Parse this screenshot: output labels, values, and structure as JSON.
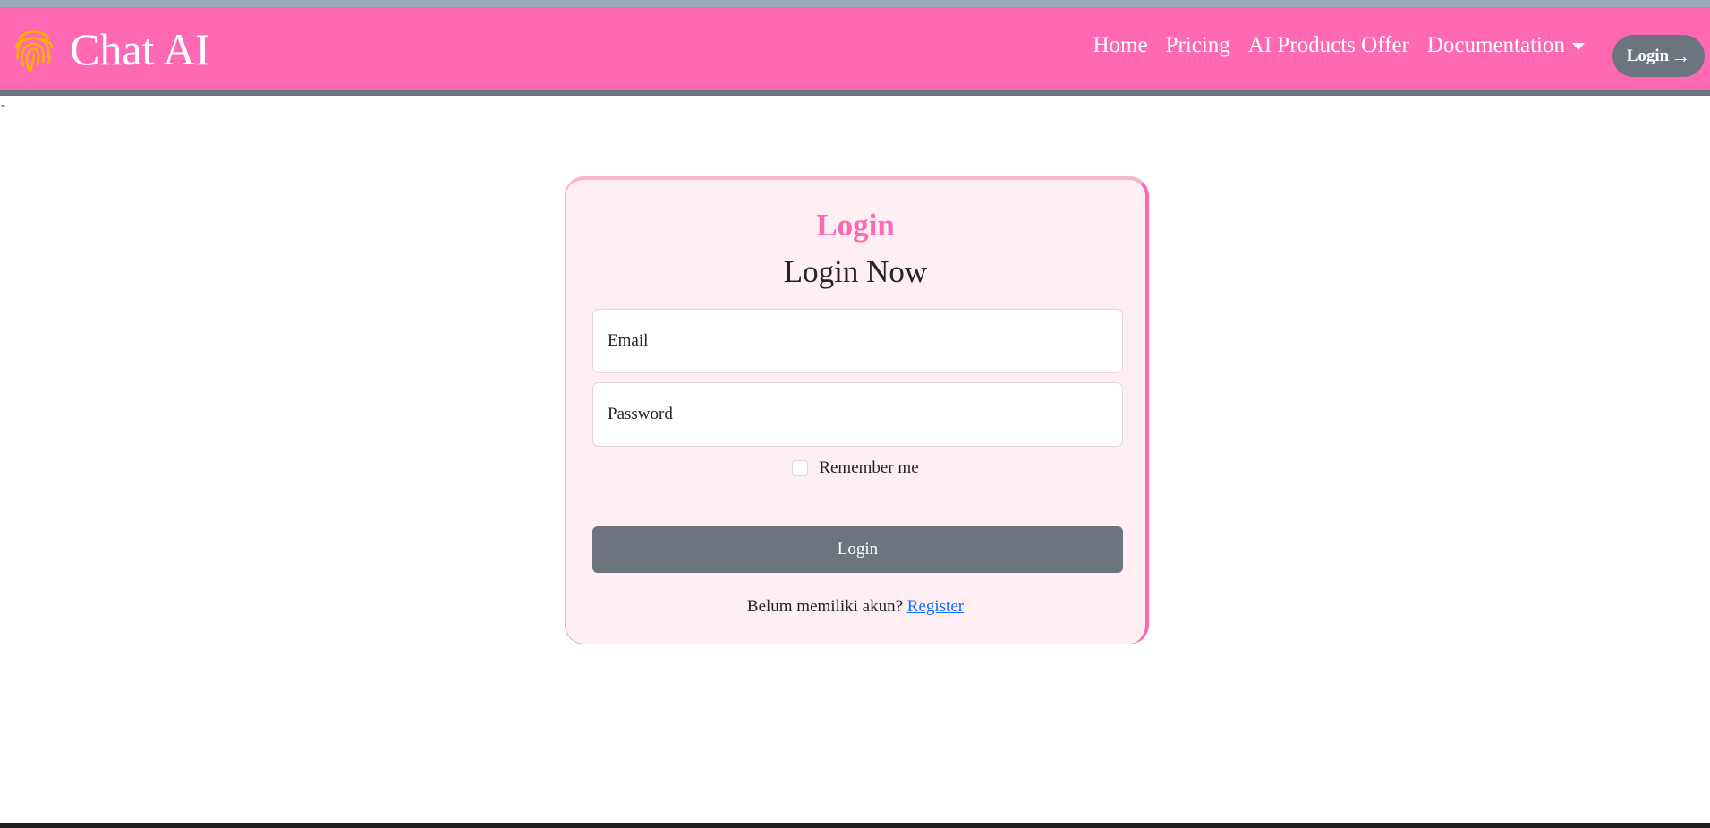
{
  "navbar": {
    "brand_icon": "fingerprint-icon",
    "brand_name": "Chat AI",
    "links": [
      "Home",
      "Pricing",
      "AI Products Offer",
      "Documentation"
    ],
    "login_label": "Login",
    "login_arrow": "→",
    "dropdown_icon": "caret-down-icon"
  },
  "dash": "-",
  "card": {
    "title": "Login",
    "subtitle": "Login Now",
    "email_placeholder": "Email",
    "password_placeholder": "Password",
    "remember_label": "Remember me",
    "remember_checked": false,
    "submit_label": "Login",
    "register_prompt": "Belum memiliki akun?",
    "register_link": "Register"
  },
  "colors": {
    "navbar": "#ff69b4",
    "accent": "#ff69b4",
    "button": "#6c757d",
    "card_bg": "#ffeef4",
    "link": "#0d6efd",
    "icon": "#ffb000"
  }
}
